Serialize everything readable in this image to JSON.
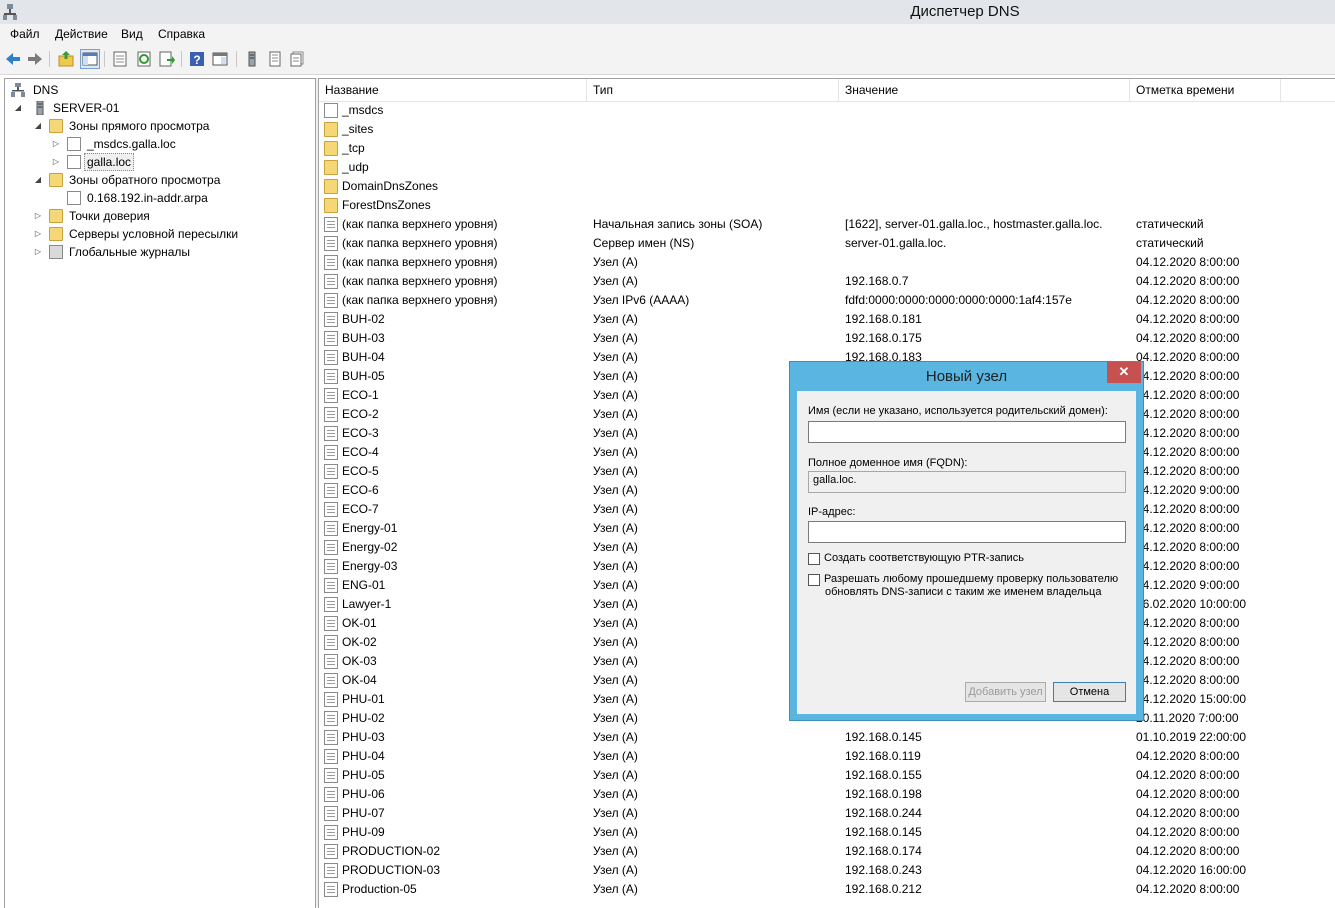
{
  "window": {
    "title": "Диспетчер DNS"
  },
  "menu": [
    "Файл",
    "Действие",
    "Вид",
    "Справка"
  ],
  "toolbar": [
    "back-icon",
    "forward-icon",
    "up-folder-icon",
    "show-tree-icon",
    "properties-icon",
    "refresh-icon",
    "export-icon",
    "help-icon",
    "console-icon",
    "server-icon",
    "list-icon",
    "records-icon"
  ],
  "tree": {
    "root": "DNS",
    "server": "SERVER-01",
    "forward_zones": "Зоны прямого просмотра",
    "msdcs_zone": "_msdcs.galla.loc",
    "galla_zone": "galla.loc",
    "reverse_zones": "Зоны обратного просмотра",
    "reverse_zone": "0.168.192.in-addr.arpa",
    "trust_points": "Точки доверия",
    "conditional_forwarders": "Серверы условной пересылки",
    "global_logs": "Глобальные журналы"
  },
  "columns": [
    "Название",
    "Тип",
    "Значение",
    "Отметка времени"
  ],
  "rows": [
    {
      "name": "_msdcs",
      "type": "",
      "value": "",
      "ts": "",
      "kind": "zone"
    },
    {
      "name": "_sites",
      "type": "",
      "value": "",
      "ts": "",
      "kind": "folder"
    },
    {
      "name": "_tcp",
      "type": "",
      "value": "",
      "ts": "",
      "kind": "folder"
    },
    {
      "name": "_udp",
      "type": "",
      "value": "",
      "ts": "",
      "kind": "folder"
    },
    {
      "name": "DomainDnsZones",
      "type": "",
      "value": "",
      "ts": "",
      "kind": "folder"
    },
    {
      "name": "ForestDnsZones",
      "type": "",
      "value": "",
      "ts": "",
      "kind": "folder"
    },
    {
      "name": "(как папка верхнего уровня)",
      "type": "Начальная запись зоны (SOA)",
      "value": "[1622], server-01.galla.loc., hostmaster.galla.loc.",
      "ts": "статический",
      "kind": "record"
    },
    {
      "name": "(как папка верхнего уровня)",
      "type": "Сервер имен (NS)",
      "value": "server-01.galla.loc.",
      "ts": "статический",
      "kind": "record"
    },
    {
      "name": "(как папка верхнего уровня)",
      "type": "Узел (A)",
      "value": "",
      "ts": "04.12.2020 8:00:00",
      "kind": "record"
    },
    {
      "name": "(как папка верхнего уровня)",
      "type": "Узел (A)",
      "value": "192.168.0.7",
      "ts": "04.12.2020 8:00:00",
      "kind": "record"
    },
    {
      "name": "(как папка верхнего уровня)",
      "type": "Узел IPv6 (AAAA)",
      "value": "fdfd:0000:0000:0000:0000:0000:1af4:157e",
      "ts": "04.12.2020 8:00:00",
      "kind": "record"
    },
    {
      "name": "BUH-02",
      "type": "Узел (A)",
      "value": "192.168.0.181",
      "ts": "04.12.2020 8:00:00",
      "kind": "record"
    },
    {
      "name": "BUH-03",
      "type": "Узел (A)",
      "value": "192.168.0.175",
      "ts": "04.12.2020 8:00:00",
      "kind": "record"
    },
    {
      "name": "BUH-04",
      "type": "Узел (A)",
      "value": "192.168.0.183",
      "ts": "04.12.2020 8:00:00",
      "kind": "record"
    },
    {
      "name": "BUH-05",
      "type": "Узел (A)",
      "value": "",
      "ts": "04.12.2020 8:00:00",
      "kind": "record"
    },
    {
      "name": "ECO-1",
      "type": "Узел (A)",
      "value": "",
      "ts": "04.12.2020 8:00:00",
      "kind": "record"
    },
    {
      "name": "ECO-2",
      "type": "Узел (A)",
      "value": "",
      "ts": "04.12.2020 8:00:00",
      "kind": "record"
    },
    {
      "name": "ECO-3",
      "type": "Узел (A)",
      "value": "",
      "ts": "04.12.2020 8:00:00",
      "kind": "record"
    },
    {
      "name": "ECO-4",
      "type": "Узел (A)",
      "value": "",
      "ts": "04.12.2020 8:00:00",
      "kind": "record"
    },
    {
      "name": "ECO-5",
      "type": "Узел (A)",
      "value": "",
      "ts": "04.12.2020 8:00:00",
      "kind": "record"
    },
    {
      "name": "ECO-6",
      "type": "Узел (A)",
      "value": "",
      "ts": "04.12.2020 9:00:00",
      "kind": "record"
    },
    {
      "name": "ECO-7",
      "type": "Узел (A)",
      "value": "",
      "ts": "04.12.2020 8:00:00",
      "kind": "record"
    },
    {
      "name": "Energy-01",
      "type": "Узел (A)",
      "value": "",
      "ts": "04.12.2020 8:00:00",
      "kind": "record"
    },
    {
      "name": "Energy-02",
      "type": "Узел (A)",
      "value": "",
      "ts": "04.12.2020 8:00:00",
      "kind": "record"
    },
    {
      "name": "Energy-03",
      "type": "Узел (A)",
      "value": "",
      "ts": "04.12.2020 8:00:00",
      "kind": "record"
    },
    {
      "name": "ENG-01",
      "type": "Узел (A)",
      "value": "",
      "ts": "04.12.2020 9:00:00",
      "kind": "record"
    },
    {
      "name": "Lawyer-1",
      "type": "Узел (A)",
      "value": "",
      "ts": "26.02.2020 10:00:00",
      "kind": "record"
    },
    {
      "name": "OK-01",
      "type": "Узел (A)",
      "value": "",
      "ts": "04.12.2020 8:00:00",
      "kind": "record"
    },
    {
      "name": "OK-02",
      "type": "Узел (A)",
      "value": "",
      "ts": "04.12.2020 8:00:00",
      "kind": "record"
    },
    {
      "name": "OK-03",
      "type": "Узел (A)",
      "value": "",
      "ts": "04.12.2020 8:00:00",
      "kind": "record"
    },
    {
      "name": "OK-04",
      "type": "Узел (A)",
      "value": "",
      "ts": "04.12.2020 8:00:00",
      "kind": "record"
    },
    {
      "name": "PHU-01",
      "type": "Узел (A)",
      "value": "",
      "ts": "04.12.2020 15:00:00",
      "kind": "record"
    },
    {
      "name": "PHU-02",
      "type": "Узел (A)",
      "value": "",
      "ts": "20.11.2020 7:00:00",
      "kind": "record"
    },
    {
      "name": "PHU-03",
      "type": "Узел (A)",
      "value": "192.168.0.145",
      "ts": "01.10.2019 22:00:00",
      "kind": "record"
    },
    {
      "name": "PHU-04",
      "type": "Узел (A)",
      "value": "192.168.0.119",
      "ts": "04.12.2020 8:00:00",
      "kind": "record"
    },
    {
      "name": "PHU-05",
      "type": "Узел (A)",
      "value": "192.168.0.155",
      "ts": "04.12.2020 8:00:00",
      "kind": "record"
    },
    {
      "name": "PHU-06",
      "type": "Узел (A)",
      "value": "192.168.0.198",
      "ts": "04.12.2020 8:00:00",
      "kind": "record"
    },
    {
      "name": "PHU-07",
      "type": "Узел (A)",
      "value": "192.168.0.244",
      "ts": "04.12.2020 8:00:00",
      "kind": "record"
    },
    {
      "name": "PHU-09",
      "type": "Узел (A)",
      "value": "192.168.0.145",
      "ts": "04.12.2020 8:00:00",
      "kind": "record"
    },
    {
      "name": "PRODUCTION-02",
      "type": "Узел (A)",
      "value": "192.168.0.174",
      "ts": "04.12.2020 8:00:00",
      "kind": "record"
    },
    {
      "name": "PRODUCTION-03",
      "type": "Узел (A)",
      "value": "192.168.0.243",
      "ts": "04.12.2020 16:00:00",
      "kind": "record"
    },
    {
      "name": "Production-05",
      "type": "Узел (A)",
      "value": "192.168.0.212",
      "ts": "04.12.2020 8:00:00",
      "kind": "record"
    }
  ],
  "dialog": {
    "title": "Новый узел",
    "close": "✕",
    "name_label": "Имя (если не указано, используется родительский домен):",
    "name_value": "",
    "fqdn_label": "Полное доменное имя (FQDN):",
    "fqdn_value": "galla.loc.",
    "ip_label": "IP-адрес:",
    "ip_value": "",
    "ptr_label": "Создать соответствующую PTR-запись",
    "allow_label_1": "Разрешать любому прошедшему проверку пользователю",
    "allow_label_2": "обновлять DNS-записи с таким же именем владельца",
    "add_button": "Добавить узел",
    "cancel_button": "Отмена"
  }
}
